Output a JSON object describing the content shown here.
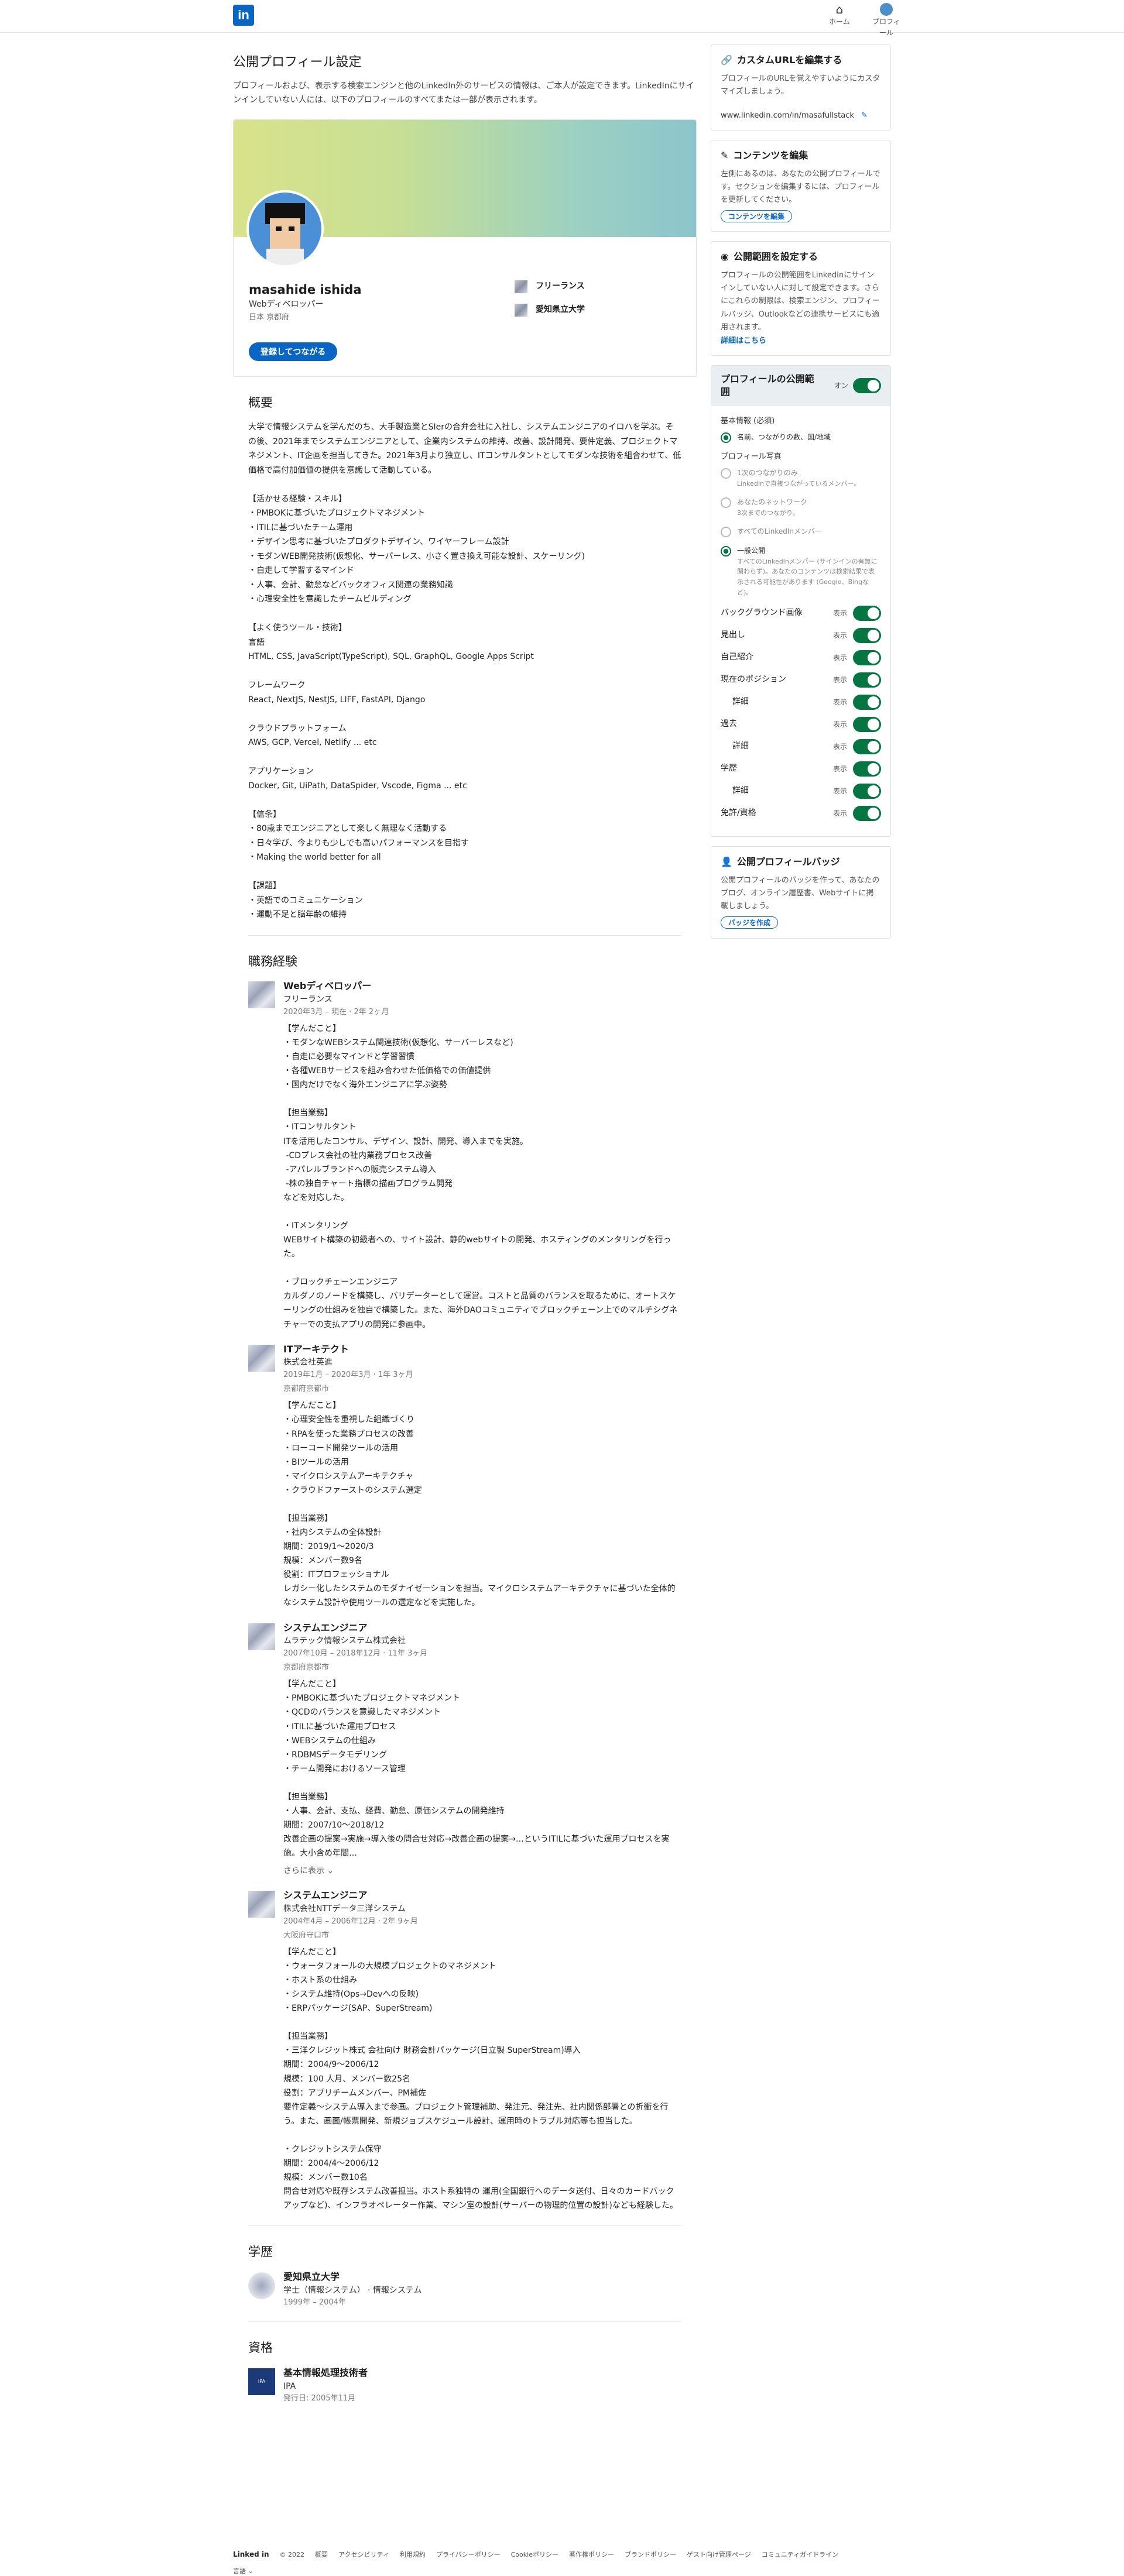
{
  "nav": {
    "logo": "in",
    "home_label": "ホーム",
    "profile_label": "プロフィール"
  },
  "header": {
    "title": "公開プロフィール設定",
    "description": "プロフィールおよび、表示する検索エンジンと他のLinkedIn外のサービスの情報は、ご本人が設定できます。LinkedInにサインインしていない人には、以下のプロフィールのすべてまたは一部が表示されます。"
  },
  "profile": {
    "name": "masahide ishida",
    "headline": "Webディベロッパー",
    "location": "日本 京都府",
    "connect_button": "登録してつながる",
    "current_company": "フリーランス",
    "school": "愛知県立大学"
  },
  "about": {
    "heading": "概要",
    "text": "大学で情報システムを学んだのち、大手製造業とSIerの合弁会社に入社し、システムエンジニアのイロハを学ぶ。その後、2021年までシステムエンジニアとして、企業内システムの維持、改善、設計開発、要件定義、プロジェクトマネジメント、IT企画を担当してきた。2021年3月より独立し、ITコンサルタントとしてモダンな技術を組合わせて、低価格で高付加価値の提供を意識して活動している。\n\n【活かせる経験・スキル】\n・PMBOKに基づいたプロジェクトマネジメント\n・ITILに基づいたチーム運用\n・デザイン思考に基づいたプロダクトデザイン、ワイヤーフレーム設計\n・モダンWEB開発技術(仮想化、サーバーレス、小さく置き換え可能な設計、スケーリング)\n・自走して学習するマインド\n・人事、会計、勤怠などバックオフィス関連の業務知識\n・心理安全性を意識したチームビルディング\n\n【よく使うツール・技術】\n言語\nHTML, CSS, JavaScript(TypeScript), SQL, GraphQL, Google Apps Script\n\nフレームワーク\nReact, NextJS, NestJS, LIFF, FastAPI, Django\n\nクラウドプラットフォーム\nAWS, GCP, Vercel, Netlify ... etc\n\nアプリケーション\nDocker, Git, UiPath, DataSpider, Vscode, Figma ... etc\n\n【信条】\n・80歳までエンジニアとして楽しく無理なく活動する\n・日々学び、今よりも少しでも高いパフォーマンスを目指す\n・Making the world better for all\n\n【課題】\n・英語でのコミュニケーション\n・運動不足と脳年齢の維持"
  },
  "experience": {
    "heading": "職務経験",
    "items": [
      {
        "title": "Webディベロッパー",
        "company": "フリーランス",
        "date": "2020年3月 – 現在 · 2年 2ヶ月",
        "location": "",
        "description": "【学んだこと】\n・モダンなWEBシステム関連技術(仮想化、サーバーレスなど)\n・自走に必要なマインドと学習習慣\n・各種WEBサービスを組み合わせた低価格での価値提供\n・国内だけでなく海外エンジニアに学ぶ姿勢\n\n【担当業務】\n・ITコンサルタント\nITを活用したコンサル、デザイン、設計、開発、導入までを実施。\n -CDプレス会社の社内業務プロセス改善\n -アパレルブランドへの販売システム導入\n -株の独自チャート指標の描画プログラム開発\nなどを対応した。\n\n・ITメンタリング\nWEBサイト構築の初級者への、サイト設計、静的webサイトの開発、ホスティングのメンタリングを行った。\n\n・ブロックチェーンエンジニア\nカルダノのノードを構築し、バリデーターとして運営。コストと品質のバランスを取るために、オートスケーリングの仕組みを独自で構築した。また、海外DAOコミュニティでブロックチェーン上でのマルチシグネチャーでの支払アプリの開発に参画中。",
        "see_more": ""
      },
      {
        "title": "ITアーキテクト",
        "company": "株式会社英進",
        "date": "2019年1月 – 2020年3月 · 1年 3ヶ月",
        "location": "京都府京都市",
        "description": "【学んだこと】\n・心理安全性を重視した組織づくり\n・RPAを使った業務プロセスの改善\n・ローコード開発ツールの活用\n・BIツールの活用\n・マイクロシステムアーキテクチャ\n・クラウドファーストのシステム選定\n\n【担当業務】\n・社内システムの全体設計\n期間：2019/1〜2020/3\n規模：メンバー数9名\n役割：ITプロフェッショナル\nレガシー化したシステムのモダナイゼーションを担当。マイクロシステムアーキテクチャに基づいた全体的なシステム設計や使用ツールの選定などを実施した。",
        "see_more": ""
      },
      {
        "title": "システムエンジニア",
        "company": "ムラテック情報システム株式会社",
        "date": "2007年10月 – 2018年12月 · 11年 3ヶ月",
        "location": "京都府京都市",
        "description": "【学んだこと】\n・PMBOKに基づいたプロジェクトマネジメント\n・QCDのバランスを意識したマネジメント\n・ITILに基づいた運用プロセス\n・WEBシステムの仕組み\n・RDBMSデータモデリング\n・チーム開発におけるソース管理\n\n【担当業務】\n・人事、会計、支払、経費、勤怠、原価システムの開発維持\n期間：2007/10〜2018/12\n改善企画の提案→実施→導入後の問合せ対応→改善企画の提案→…というITILに基づいた運用プロセスを実施。大小含め年間…",
        "see_more": "さらに表示 ⌄"
      },
      {
        "title": "システムエンジニア",
        "company": "株式会社NTTデータ三洋システム",
        "date": "2004年4月 – 2006年12月 · 2年 9ヶ月",
        "location": "大阪府守口市",
        "description": "【学んだこと】\n・ウォータフォールの大規模プロジェクトのマネジメント\n・ホスト系の仕組み\n・システム維持(Ops→Devへの反映)\n・ERPパッケージ(SAP、SuperStream)\n\n【担当業務】\n・三洋クレジット株式 会社向け 財務会計パッケージ(日立製 SuperStream)導入\n期間：2004/9〜2006/12\n規模：100 人月、メンバー数25名\n役割：アプリチームメンバー、PM補佐\n要件定義〜システム導入まで参画。プロジェクト管理補助、発注元、発注先、社内関係部署との折衝を行う。また、画面/帳票開発、新規ジョブスケジュール設計、運用時のトラブル対応等も担当した。\n\n・クレジットシステム保守\n期間：2004/4〜2006/12\n規模：メンバー数10名\n問合せ対応や既存システム改善担当。ホスト系独特の 運用(全国銀行へのデータ送付、日々のカードバックアップなど)、インフラオペレーター作業、マシン室の設計(サーバーの物理的位置の設計)なども経験した。",
        "see_more": ""
      }
    ]
  },
  "education": {
    "heading": "学歴",
    "school": "愛知県立大学",
    "degree": "学士（情報システム） · 情報システム",
    "years": "1999年 – 2004年"
  },
  "certifications": {
    "heading": "資格",
    "name": "基本情報処理技術者",
    "issuer": "IPA",
    "date": "発行日: 2005年11月",
    "logo_text": "IPA"
  },
  "sidebar": {
    "custom_url": {
      "title": "カスタムURLを編集する",
      "description": "プロフィールのURLを覚えやすいようにカスタマイズしましょう。",
      "url": "www.linkedin.com/in/masafullstack"
    },
    "content": {
      "title": "コンテンツを編集",
      "description": "左側にあるのは、あなたの公開プロフィールです。セクションを編集するには、プロフィールを更新してください。",
      "button": "コンテンツを編集"
    },
    "visibility": {
      "title": "公開範囲を設定する",
      "description": "プロフィールの公開範囲をLinkedInにサインインしていない人に対して設定できます。さらにこれらの制限は、検索エンジン、プロフィールバッジ、Outlookなどの連携サービスにも適用されます。",
      "link": "詳細はこちら"
    },
    "public_profile": {
      "title": "プロフィールの公開範囲",
      "toggle_state": "オン",
      "basic_info_label": "基本情報 (必須)",
      "basic_info_value": "名前、つながりの数、国/地域",
      "photo_label": "プロフィール写真",
      "photo_options": [
        {
          "label": "1次のつながりのみ",
          "desc": "LinkedInで直接つながっているメンバー。",
          "selected": false
        },
        {
          "label": "あなたのネットワーク",
          "desc": "3次までのつながり。",
          "selected": false
        },
        {
          "label": "すべてのLinkedInメンバー",
          "desc": "",
          "selected": false
        },
        {
          "label": "一般公開",
          "desc": "すべてのLinkedInメンバー (サインインの有無に関わらず)。あなたのコンテンツは検索結果で表示される可能性があります (Google、Bingなど)。",
          "selected": true
        }
      ],
      "show_label": "表示",
      "toggles": [
        {
          "label": "バックグラウンド画像",
          "indent": false
        },
        {
          "label": "見出し",
          "indent": false
        },
        {
          "label": "自己紹介",
          "indent": false
        },
        {
          "label": "現在のポジション",
          "indent": false
        },
        {
          "label": "詳細",
          "indent": true
        },
        {
          "label": "過去",
          "indent": false
        },
        {
          "label": "詳細",
          "indent": true
        },
        {
          "label": "学歴",
          "indent": false
        },
        {
          "label": "詳細",
          "indent": true
        },
        {
          "label": "免許/資格",
          "indent": false
        }
      ]
    },
    "badge": {
      "title": "公開プロフィールバッジ",
      "description": "公開プロフィールのバッジを作って、あなたのブログ、オンライン履歴書、Webサイトに掲載しましょう。",
      "button": "バッジを作成"
    }
  },
  "footer": {
    "logo": "Linked in",
    "copyright": "© 2022",
    "links": [
      "概要",
      "アクセシビリティ",
      "利用規約",
      "プライバシーポリシー",
      "Cookieポリシー",
      "著作権ポリシー",
      "ブランドポリシー",
      "ゲスト向け管理ページ",
      "コミュニティガイドライン"
    ],
    "language": "言語 ⌄"
  },
  "colors": {
    "brand": "#0a66c2",
    "toggle_on": "#057642"
  }
}
